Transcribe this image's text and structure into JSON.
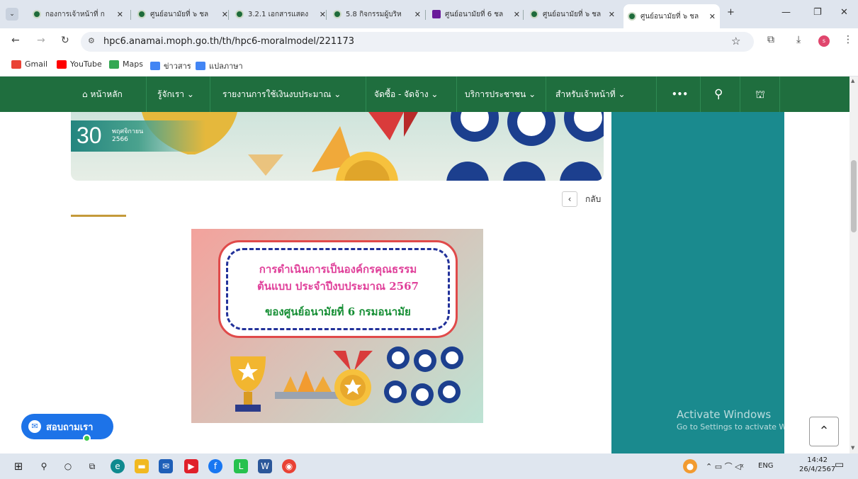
{
  "browser": {
    "tabs": [
      {
        "title": "กองการเจ้าหน้าที่ ก",
        "favicon": "anamai-logo-icon"
      },
      {
        "title": "ศูนย์อนามัยที่ ๖ ชล",
        "favicon": "anamai-logo-icon"
      },
      {
        "title": "3.2.1 เอกสารแสดง",
        "favicon": "anamai-logo-icon"
      },
      {
        "title": "5.8 กิจกรรมผู้บริห",
        "favicon": "anamai-logo-icon"
      },
      {
        "title": "ศูนย์อนามัยที่ 6 ชล",
        "favicon": "yahoo-icon"
      },
      {
        "title": "ศูนย์อนามัยที่ ๖ ชล",
        "favicon": "anamai-logo-icon"
      },
      {
        "title": "ศูนย์อนามัยที่ ๖ ชล",
        "favicon": "anamai-logo-icon"
      }
    ],
    "url": "hpc6.anamai.moph.go.th/th/hpc6-moralmodel/221173",
    "bookmarks": [
      {
        "label": "Gmail",
        "color": "#ea4335"
      },
      {
        "label": "YouTube",
        "color": "#ff0000"
      },
      {
        "label": "Maps",
        "color": "#34a853"
      },
      {
        "label": "ข่าวสาร",
        "color": "#4285f4"
      },
      {
        "label": "แปลภาษา",
        "color": "#4285f4"
      }
    ],
    "profile_initial": "s"
  },
  "site": {
    "nav": {
      "home": "หน้าหลัก",
      "about": "รู้จักเรา",
      "budget": "รายงานการใช้เงินงบประมาณ",
      "procurement": "จัดซื้อ - จัดจ้าง",
      "services": "บริการประชาชน",
      "staff": "สำหรับเจ้าหน้าที่",
      "more": "•••"
    },
    "date": {
      "day": "30",
      "month": "พฤศจิกายน",
      "year": "2566"
    },
    "back_label": "กลับ",
    "poster": {
      "line1": "การดำเนินการเป็นองค์กรคุณธรรม",
      "line2": "ต้นแบบ ประจำปีงบประมาณ 2567",
      "line3": "ของศูนย์อนามัยที่ 6 กรมอนามัย"
    },
    "chat_label": "สอบถามเรา",
    "watermark": {
      "line1": "Activate Windows",
      "line2": "Go to Settings to activate Windows."
    }
  },
  "taskbar": {
    "lang": "ENG",
    "time": "14:42",
    "date": "26/4/2567"
  },
  "colors": {
    "nav_green": "#1f6e3e",
    "sidebar_teal": "#1a8a8e",
    "accent_gold": "#c49a3a",
    "chat_blue": "#1d73e8"
  }
}
